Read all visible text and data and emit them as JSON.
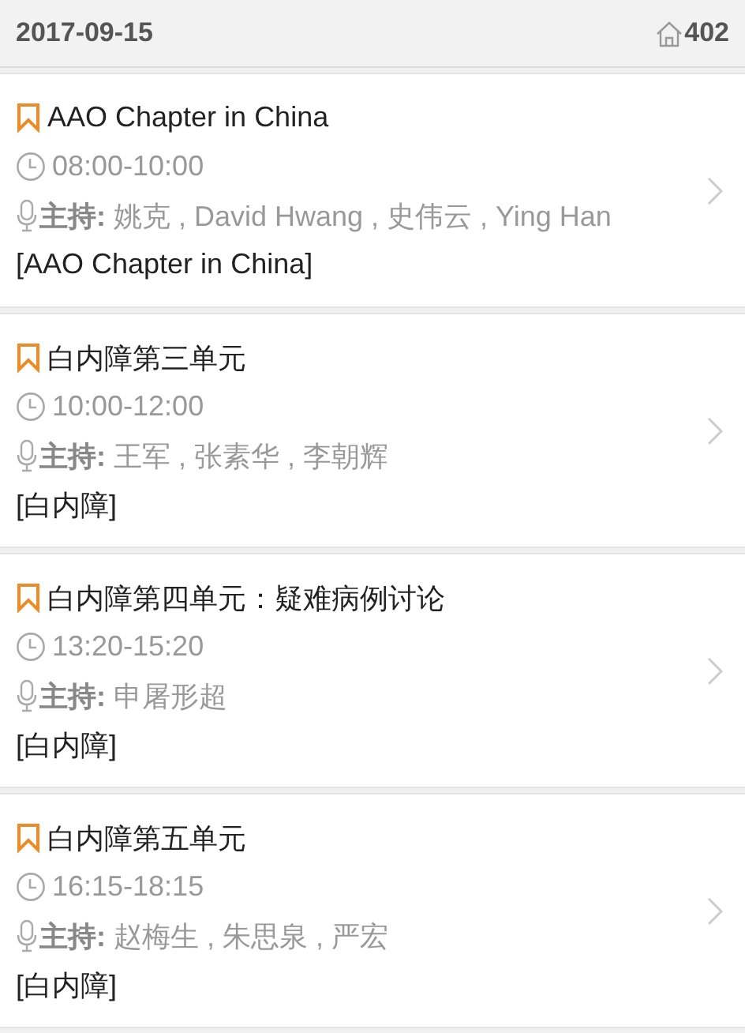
{
  "header": {
    "date": "2017-09-15",
    "room": "402"
  },
  "sessions": [
    {
      "title": "AAO Chapter in China",
      "time": "08:00-10:00",
      "hosts": "**主持:** 姚克 , David Hwang , 史伟云 , Ying Han",
      "track": "[AAO Chapter in China]"
    },
    {
      "title": "白内障第三单元",
      "time": "10:00-12:00",
      "hosts": "**主持:** 王军 , 张素华 , 李朝辉",
      "track": "[白内障]"
    },
    {
      "title": "白内障第四单元：疑难病例讨论",
      "time": "13:20-15:20",
      "hosts": "**主持:** 申屠形超",
      "track": "[白内障]"
    },
    {
      "title": "白内障第五单元",
      "time": "16:15-18:15",
      "hosts": "**主持:** 赵梅生 , 朱思泉 , 严宏",
      "track": "[白内障]"
    }
  ]
}
